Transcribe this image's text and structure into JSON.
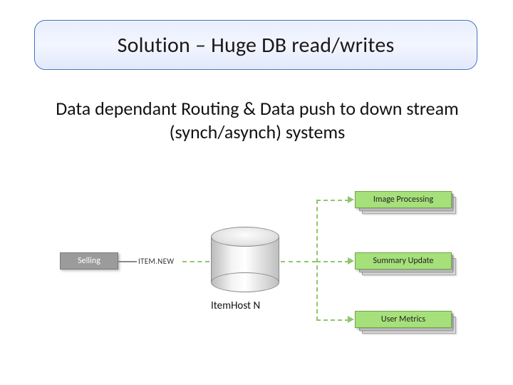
{
  "title": "Solution – Huge DB read/writes",
  "subtitle": "Data dependant Routing & Data push to down stream (synch/asynch) systems",
  "diagram": {
    "source_node": "Selling",
    "event_label": "ITEM.NEW",
    "db_label": "ItemHost N",
    "targets": [
      "Image Processing",
      "Summary Update",
      "User Metrics"
    ]
  },
  "colors": {
    "banner_border": "#3f6ec3",
    "target_green": "#a6e07b",
    "dash_green": "#8fc76b",
    "source_gray": "#9b9b9b"
  }
}
